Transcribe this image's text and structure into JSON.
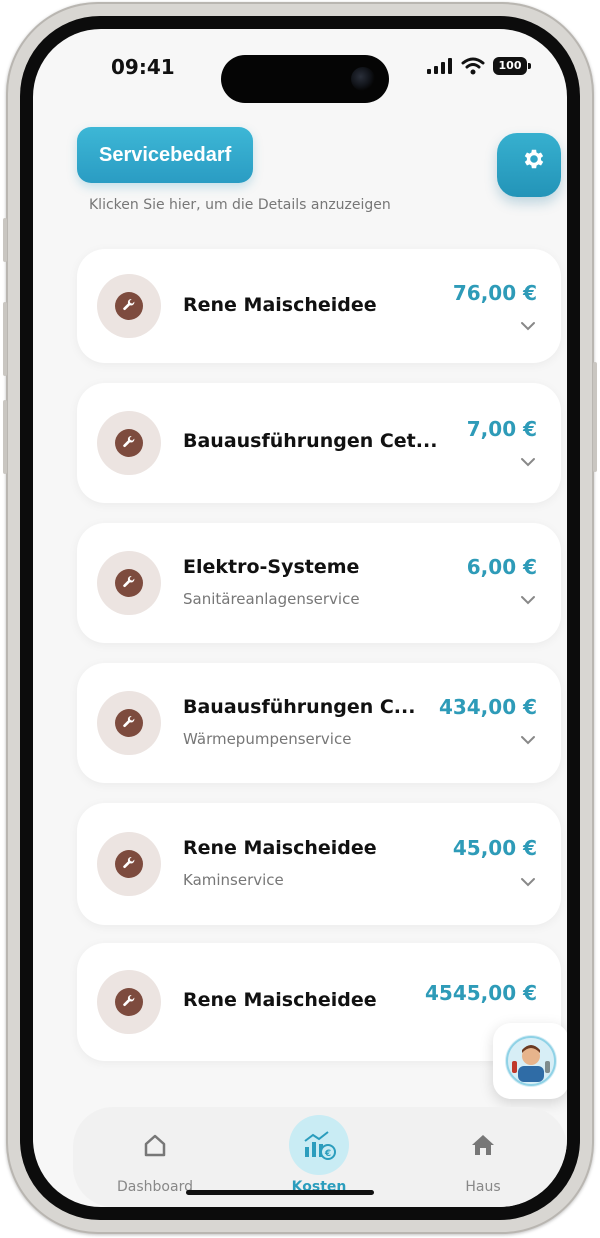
{
  "status_bar": {
    "time": "09:41",
    "battery": "100"
  },
  "header": {
    "title": "Servicebedarf",
    "subtitle": "Klicken Sie hier, um die Details anzuzeigen",
    "settings_icon": "gear-icon"
  },
  "services": [
    {
      "title": "Rene Maischeidee",
      "subtitle": "",
      "amount": "76,00 €"
    },
    {
      "title": "Bauausführungen Cet...",
      "subtitle": "",
      "amount": "7,00 €"
    },
    {
      "title": "Elektro-Systeme",
      "subtitle": "Sanitäreanlagenservice",
      "amount": "6,00 €"
    },
    {
      "title": "Bauausführungen C...",
      "subtitle": "Wärmepumpenservice",
      "amount": "434,00 €"
    },
    {
      "title": "Rene Maischeidee",
      "subtitle": "Kaminservice",
      "amount": "45,00 €"
    },
    {
      "title": "Rene Maischeidee",
      "subtitle": "",
      "amount": "4545,00 €"
    }
  ],
  "bottom_nav": [
    {
      "label": "Dashboard",
      "icon": "home-outline-icon",
      "active": false
    },
    {
      "label": "Kosten",
      "icon": "cost-chart-icon",
      "active": true
    },
    {
      "label": "Haus",
      "icon": "house-icon",
      "active": false
    }
  ],
  "colors": {
    "accent": "#2e9bb8",
    "wrench_icon": "#7d4b3e",
    "icon_background": "#ece4e1",
    "background": "#f7f7f7"
  }
}
